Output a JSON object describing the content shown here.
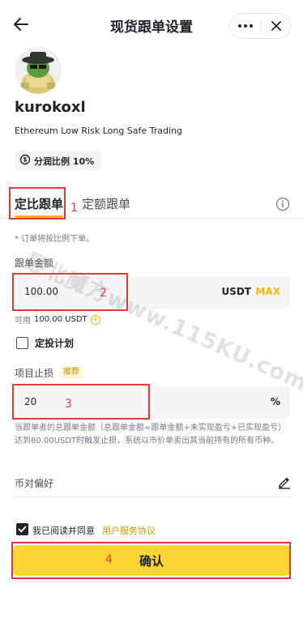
{
  "header": {
    "title": "现货跟单设置"
  },
  "profile": {
    "username": "kurokoxl",
    "description": "Ethereum Low Risk Long Safe Trading",
    "profit_share_label": "分润比例 10%"
  },
  "tabs": [
    {
      "label": "定比跟单",
      "active": true
    },
    {
      "label": "定额跟单",
      "active": false
    }
  ],
  "note": "* 订单将按比例下单。",
  "amount": {
    "label": "跟单金额",
    "value": "100.00",
    "unit": "USDT",
    "max_label": "MAX",
    "available_prefix": "可用",
    "available_value": "100.00 USDT"
  },
  "plan": {
    "label": "定投计划",
    "checked": false
  },
  "stop_loss": {
    "label": "项目止损",
    "badge": "推荐",
    "value": "20",
    "unit": "%",
    "description": "当跟单者的总跟单金额（总跟单金额=跟单金额+未实现盈亏+已实现盈亏）达到80.00USDT时触发止损，系统以市价单卖出其当前持有的所有币种。"
  },
  "pair_pref": {
    "label": "币对偏好"
  },
  "agreement": {
    "text": "我已阅读并同意",
    "link": "用户服务协议",
    "checked": true
  },
  "confirm": {
    "label": "确认"
  },
  "annotations": {
    "n1": "1",
    "n2": "2",
    "n3": "3",
    "n4": "4"
  },
  "watermark": "最北魔方www.115KU.com",
  "colors": {
    "accent": "#f0b90b",
    "button": "#fcd535",
    "annotation": "#e53935"
  }
}
